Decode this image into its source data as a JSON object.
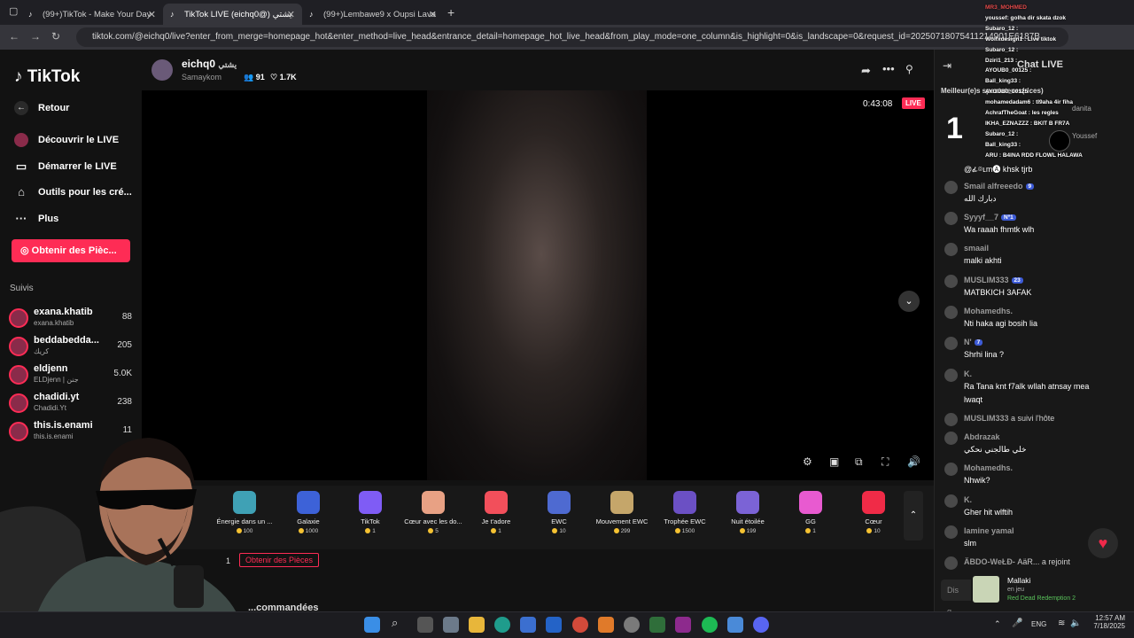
{
  "tabs": [
    {
      "label": "(99+)TikTok - Make Your Day"
    },
    {
      "label": "TikTok LIVE (eichq0@) يشتي"
    },
    {
      "label": "(99+)Lembawe9 x Oupsi Lava"
    }
  ],
  "address_url": "tiktok.com/@eichq0/live?enter_from_merge=homepage_hot&enter_method=live_head&entrance_detail=homepage_hot_live_head&from_play_mode=one_column&is_highlight=0&is_landscape=0&request_id=20250718075411214901E6187B",
  "sidebar": {
    "logo": "TikTok",
    "back": "Retour",
    "items": [
      "Découvrir le LIVE",
      "Démarrer le LIVE",
      "Outils pour les cré...",
      "Plus"
    ],
    "coins_button": "Obtenir des Pièc...",
    "following_title": "Suivis",
    "following": [
      {
        "name": "exana.khatib",
        "sub": "exana.khatib",
        "count": "88"
      },
      {
        "name": "beddabedda...",
        "sub": "كريك",
        "count": "205"
      },
      {
        "name": "eldjenn",
        "sub": "ELDjenn | جنن",
        "count": "5.0K"
      },
      {
        "name": "chadidi.yt",
        "sub": "Chadidi.Yt",
        "count": "238"
      },
      {
        "name": "this.is.enami",
        "sub": "this.is.enami",
        "count": "11"
      }
    ]
  },
  "live": {
    "host": "eichq0",
    "host_arabic": "يشتي",
    "host_sub": "Samaykom",
    "viewers": "91",
    "likes": "1.7K",
    "timer": "0:43:08",
    "live_badge": "LIVE"
  },
  "gifts": [
    {
      "name": "Énergie dans un ...",
      "price": "100",
      "color": "#3fa1b5"
    },
    {
      "name": "Galaxie",
      "price": "1000",
      "color": "#3d62d8"
    },
    {
      "name": "TikTok",
      "price": "1",
      "color": "#7f5cf5"
    },
    {
      "name": "Cœur avec les do...",
      "price": "5",
      "color": "#e8a184"
    },
    {
      "name": "Je t'adore",
      "price": "1",
      "color": "#f24f5b"
    },
    {
      "name": "EWC",
      "price": "10",
      "color": "#4e6ad1"
    },
    {
      "name": "Mouvement EWC",
      "price": "299",
      "color": "#c5a66a"
    },
    {
      "name": "Trophée EWC",
      "price": "1500",
      "color": "#6b50c4"
    },
    {
      "name": "Nuit étoilée",
      "price": "199",
      "color": "#7b63d6"
    },
    {
      "name": "GG",
      "price": "1",
      "color": "#e85ad0"
    },
    {
      "name": "Cœur",
      "price": "10",
      "color": "#f02b47"
    }
  ],
  "get_coins": "Obtenir des Pièces",
  "coin_count": "1",
  "recommended": "...commandées",
  "chat": {
    "header": "Chat LIVE",
    "top_viewers": "Meilleur(e)s spectateurs(rices)",
    "rank": "1",
    "top_names": [
      "danita",
      "Youssef"
    ],
    "messages": [
      {
        "user": "",
        "text": "@ፊ⌾ʟm🅐 khsk tjrb"
      },
      {
        "user": "Smail alfreeedo",
        "badge": "9",
        "text": "دبارك الله"
      },
      {
        "user": "Syyyf__7",
        "badge": "Nº1",
        "text": "Wa raaah fhmtk wlh"
      },
      {
        "user": "smaail",
        "text": "malki akhti"
      },
      {
        "user": "MUSLIM333",
        "badge": "23",
        "text": "MATBKICH 3AFAK"
      },
      {
        "user": "Mohamedhs.",
        "text": "Nti haka agi bosih lia"
      },
      {
        "user": "N'",
        "badge": "7",
        "text": "Shrhi lina ?"
      },
      {
        "user": "K.",
        "text": "Ra Tana knt f7alk wllah atnsay mea"
      },
      {
        "user": "",
        "text": "lwaqt"
      },
      {
        "user": "MUSLIM333",
        "text": "a suivi l'hôte"
      },
      {
        "user": "Abdrazak",
        "text": "خلي طالجني نحكي"
      },
      {
        "user": "Mohamedhs.",
        "text": "Nhwik?"
      },
      {
        "user": "K.",
        "text": "Gher hit wlftih"
      },
      {
        "user": "lamine yamal",
        "text": "slm"
      },
      {
        "user": "ÄBDO-WeŁÐ-",
        "text": "AäR... a rejoint"
      }
    ],
    "input_placeholder": "Dis q..."
  },
  "overlay_chat": [
    "MR3_MOHMED",
    "youssef: golha dir skata dzok",
    "Subaro_12 :",
    "Wolfxdesign1 : Live tiktok",
    "Subaro_12 :",
    "Dziri1_213 :",
    "AYOUB0_00125 :",
    "Ball_king33 :",
    "AYOUB0_00125 :",
    "mohamedadam6 : tl9aha 4ir fiha",
    "AchrafTheGoat : les regles",
    "IKHA_EZNAZZZ : BKIT B FR7A",
    "Subaro_12 :",
    "Ball_king33 :",
    "ARU : B4INA RDD FLOWL HALAWA"
  ],
  "game_overlay": {
    "name": "Mallaki",
    "status": "en jeu",
    "game": "Red Dead Redemption 2"
  },
  "taskbar": {
    "lang": "ENG",
    "time": "12:57 AM",
    "date": "7/18/2025"
  }
}
